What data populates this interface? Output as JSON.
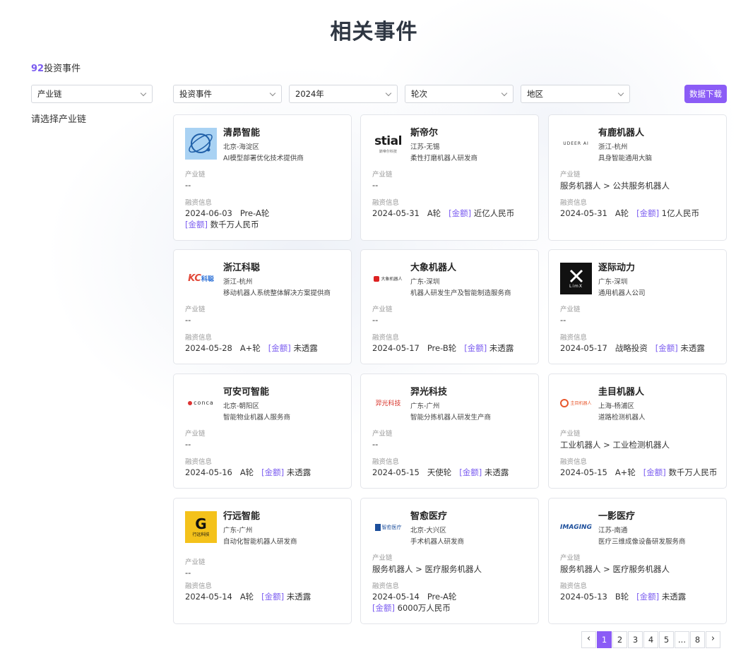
{
  "page": {
    "title": "相关事件",
    "count": "92",
    "count_label": "投资事件"
  },
  "sidebar": {
    "select_label": "产业链",
    "hint": "请选择产业链"
  },
  "filters": {
    "event_type": "投资事件",
    "year": "2024年",
    "round": "轮次",
    "region": "地区",
    "download_label": "数据下载"
  },
  "labels": {
    "chain": "产业链",
    "finance": "融资信息",
    "amount_tag": "[金额]"
  },
  "cards": [
    {
      "name": "清昴智能",
      "location": "北京-海淀区",
      "desc": "AI模型部署优化技术提供商",
      "chain": "--",
      "date": "2024-06-03",
      "round": "Pre-A轮",
      "amount": "数千万人民币"
    },
    {
      "name": "斯帝尔",
      "location": "江苏-无锡",
      "desc": "柔性打磨机器人研发商",
      "chain": "--",
      "date": "2024-05-31",
      "round": "A轮",
      "amount": "近亿人民币"
    },
    {
      "name": "有鹿机器人",
      "location": "浙江-杭州",
      "desc": "具身智能通用大脑",
      "chain": "服务机器人 > 公共服务机器人",
      "date": "2024-05-31",
      "round": "A轮",
      "amount": "1亿人民币"
    },
    {
      "name": "浙江科聪",
      "location": "浙江-杭州",
      "desc": "移动机器人系统整体解决方案提供商",
      "chain": "--",
      "date": "2024-05-28",
      "round": "A+轮",
      "amount": "未透露"
    },
    {
      "name": "大象机器人",
      "location": "广东-深圳",
      "desc": "机器人研发生产及智能制造服务商",
      "chain": "--",
      "date": "2024-05-17",
      "round": "Pre-B轮",
      "amount": "未透露"
    },
    {
      "name": "逐际动力",
      "location": "广东-深圳",
      "desc": "通用机器人公司",
      "chain": "--",
      "date": "2024-05-17",
      "round": "战略投资",
      "amount": "未透露"
    },
    {
      "name": "可安可智能",
      "location": "北京-朝阳区",
      "desc": "智能物业机器人服务商",
      "chain": "--",
      "date": "2024-05-16",
      "round": "A轮",
      "amount": "未透露"
    },
    {
      "name": "羿光科技",
      "location": "广东-广州",
      "desc": "智能分拣机器人研发生产商",
      "chain": "--",
      "date": "2024-05-15",
      "round": "天使轮",
      "amount": "未透露"
    },
    {
      "name": "圭目机器人",
      "location": "上海-杨浦区",
      "desc": "道路检测机器人",
      "chain": "工业机器人 > 工业检测机器人",
      "date": "2024-05-15",
      "round": "A+轮",
      "amount": "数千万人民币"
    },
    {
      "name": "行远智能",
      "location": "广东-广州",
      "desc": "自动化智能机器人研发商",
      "chain": "--",
      "date": "2024-05-14",
      "round": "A轮",
      "amount": "未透露"
    },
    {
      "name": "智愈医疗",
      "location": "北京-大兴区",
      "desc": "手术机器人研发商",
      "chain": "服务机器人 > 医疗服务机器人",
      "date": "2024-05-14",
      "round": "Pre-A轮",
      "amount": "6000万人民币"
    },
    {
      "name": "一影医疗",
      "location": "江苏-南通",
      "desc": "医疗三维成像设备研发服务商",
      "chain": "服务机器人 > 医疗服务机器人",
      "date": "2024-05-13",
      "round": "B轮",
      "amount": "未透露"
    }
  ],
  "logos": {
    "stial": "stial",
    "stial_sub": "斯帝尔科技",
    "udeer": "UDEER AI",
    "kc_main": "KC",
    "kc_cn": "科聪",
    "elephant": "大象机器人",
    "limx": "LimX",
    "conca": "conca",
    "yiguang": "羿光科技",
    "guimu": "圭目机器人",
    "xingyuan": "行远科技",
    "zhiyu": "智愈医疗",
    "imaging": "IMAGING"
  },
  "pagination": {
    "pages": [
      "1",
      "2",
      "3",
      "4",
      "5",
      "...",
      "8"
    ],
    "active": "1",
    "prev": "‹",
    "next": "›"
  },
  "colors": {
    "accent": "#8b5cf6",
    "accent_text": "#7b5cf0"
  }
}
